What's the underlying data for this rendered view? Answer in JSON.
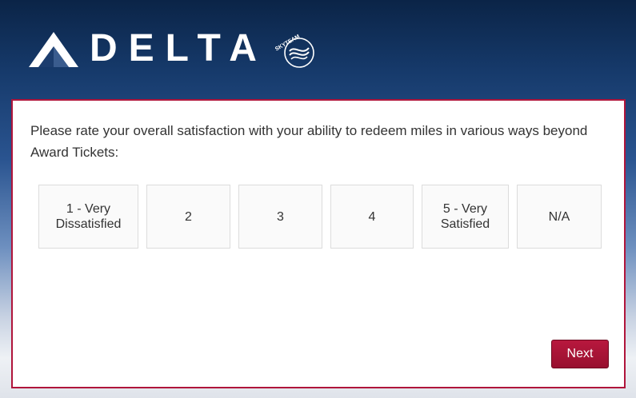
{
  "header": {
    "brand_name": "DELTA",
    "alliance_name": "SKYTEAM",
    "logo_icon": "delta-widget-icon",
    "alliance_icon": "skyteam-icon"
  },
  "survey": {
    "question": "Please rate your overall satisfaction with your ability to redeem miles in various ways beyond Award Tickets:",
    "options": [
      {
        "label": "1 - Very\nDissatisfied"
      },
      {
        "label": "2"
      },
      {
        "label": "3"
      },
      {
        "label": "4"
      },
      {
        "label": "5 - Very\nSatisfied"
      },
      {
        "label": "N/A"
      }
    ],
    "next_label": "Next"
  },
  "colors": {
    "accent": "#b0153b",
    "button": "#a8143a",
    "header_top": "#0b2447"
  }
}
